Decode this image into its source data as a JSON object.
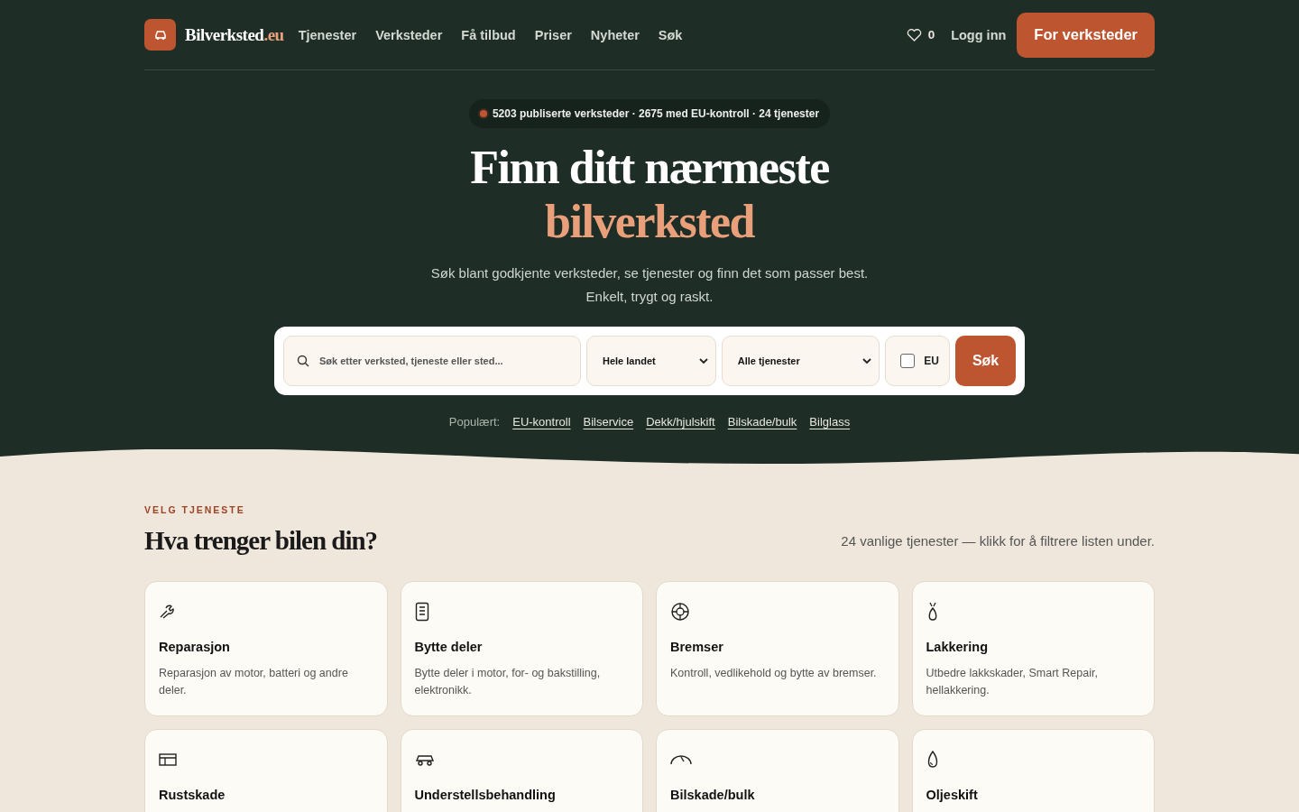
{
  "header": {
    "logo": {
      "name": "Bilverksted",
      "tld": ".eu"
    },
    "nav": [
      "Tjenester",
      "Verksteder",
      "Få tilbud",
      "Priser",
      "Nyheter",
      "Søk"
    ],
    "favorites_count": "0",
    "login": "Logg inn",
    "cta": "For verksteder"
  },
  "hero": {
    "stats": "5203 publiserte verksteder · 2675 med EU-kontroll · 24 tjenester",
    "title_line_1": "Finn ditt nærmeste",
    "title_line_2": "bilverksted",
    "subtitle_line_1": "Søk blant godkjente verksteder, se tjenester og finn det som passer best.",
    "subtitle_line_2": "Enkelt, trygt og raskt.",
    "search": {
      "placeholder": "Søk etter verksted, tjeneste eller sted...",
      "region": "Hele landet",
      "service": "Alle tjenester",
      "eu_label": "EU",
      "eu_checked": false,
      "button": "Søk"
    },
    "popular_label": "Populært:",
    "popular": [
      "EU-kontroll",
      "Bilservice",
      "Dekk/hjulskift",
      "Bilskade/bulk",
      "Bilglass"
    ]
  },
  "services": {
    "eyebrow": "VELG TJENESTE",
    "title": "Hva trenger bilen din?",
    "note": "24 vanlige tjenester — klikk for å filtrere listen under.",
    "cards": [
      {
        "kind": "wrench",
        "title": "Reparasjon",
        "text": "Reparasjon av motor, batteri og andre deler."
      },
      {
        "kind": "document",
        "title": "Bytte deler",
        "text": "Bytte deler i motor, for- og bakstilling, elektronikk."
      },
      {
        "kind": "target",
        "title": "Bremser",
        "text": "Kontroll, vedlikehold og bytte av bremser."
      },
      {
        "kind": "spray",
        "title": "Lakkering",
        "text": "Utbedre lakkskader, Smart Repair, hellakkering."
      },
      {
        "kind": "panel",
        "title": "Rustskade"
      },
      {
        "kind": "car",
        "title": "Understellsbehandling"
      },
      {
        "kind": "dent",
        "title": "Bilskade/bulk"
      },
      {
        "kind": "drop",
        "title": "Oljeskift"
      }
    ]
  }
}
